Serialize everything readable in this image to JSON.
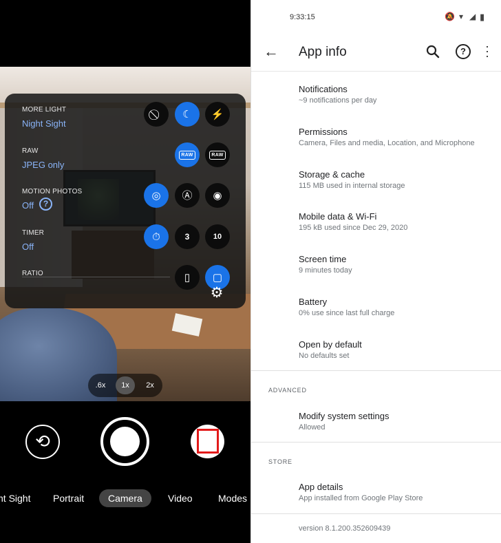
{
  "camera": {
    "settings": {
      "more_light": {
        "title": "MORE LIGHT",
        "value": "Night Sight"
      },
      "raw": {
        "title": "RAW",
        "value": "JPEG only",
        "raw_badge": "RAW"
      },
      "motion_photos": {
        "title": "MOTION PHOTOS",
        "value": "Off",
        "help": "?"
      },
      "timer": {
        "title": "TIMER",
        "value": "Off",
        "opt_3": "3",
        "opt_10": "10"
      },
      "ratio": {
        "title": "RATIO"
      }
    },
    "zoom": {
      "options": [
        ".6x",
        "1x",
        "2x"
      ],
      "selected": "1x"
    },
    "modes": [
      "nt Sight",
      "Portrait",
      "Camera",
      "Video",
      "Modes"
    ],
    "selected_mode": "Camera"
  },
  "status_bar": {
    "time": "9:33:15"
  },
  "app_info": {
    "title": "App info",
    "items": [
      {
        "title": "Notifications",
        "subtitle": "~9 notifications per day"
      },
      {
        "title": "Permissions",
        "subtitle": "Camera, Files and media, Location, and Microphone"
      },
      {
        "title": "Storage & cache",
        "subtitle": "115 MB used in internal storage"
      },
      {
        "title": "Mobile data & Wi-Fi",
        "subtitle": "195 kB used since Dec 29, 2020"
      },
      {
        "title": "Screen time",
        "subtitle": "9 minutes today"
      },
      {
        "title": "Battery",
        "subtitle": "0% use since last full charge"
      },
      {
        "title": "Open by default",
        "subtitle": "No defaults set"
      }
    ],
    "advanced": {
      "header": "ADVANCED",
      "items": [
        {
          "title": "Modify system settings",
          "subtitle": "Allowed"
        }
      ]
    },
    "store": {
      "header": "STORE",
      "items": [
        {
          "title": "App details",
          "subtitle": "App installed from Google Play Store"
        }
      ]
    },
    "version": "version 8.1.200.352609439"
  },
  "colors": {
    "accent": "#1a73e8",
    "accent_text": "#8ab4f8",
    "gallery_frame": "#e21a1a"
  }
}
